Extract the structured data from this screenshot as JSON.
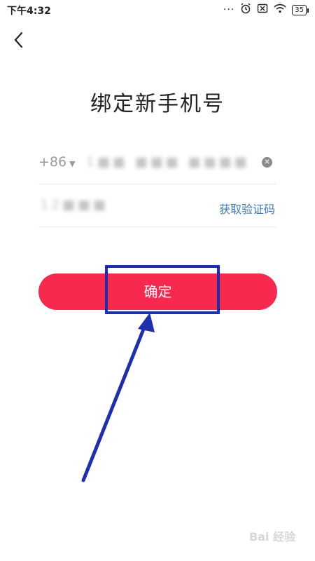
{
  "status_bar": {
    "time": "下午4:32",
    "battery": "35"
  },
  "page": {
    "title": "绑定新手机号"
  },
  "phone_row": {
    "country_code": "+86",
    "phone_number": "1■■ ■■■ ■■■■"
  },
  "code_row": {
    "code_value": "12■■■",
    "get_code_label": "获取验证码"
  },
  "confirm_button": {
    "label": "确定"
  },
  "colors": {
    "accent": "#f7294e",
    "link": "#3f78b8",
    "annotation": "#1d2fae"
  },
  "watermark": {
    "text": "Bai 经验"
  }
}
